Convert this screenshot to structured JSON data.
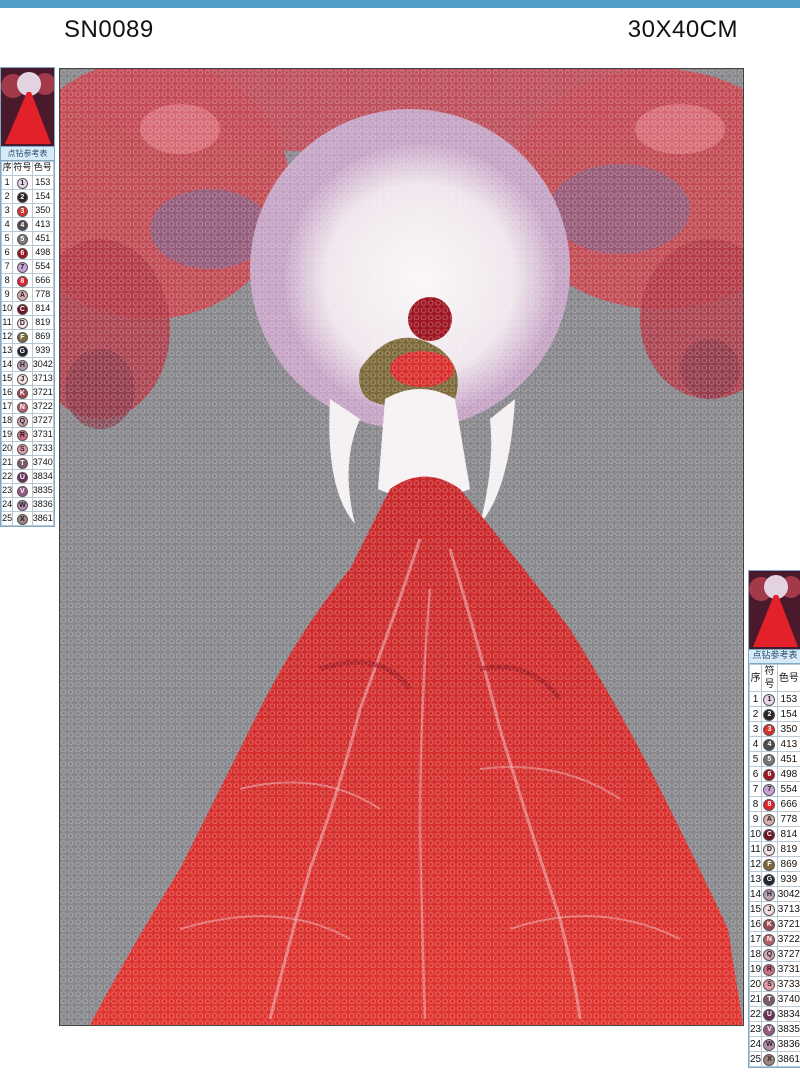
{
  "header": {
    "code": "SN0089",
    "size": "30X40CM"
  },
  "legend": {
    "title": "点钻参考表",
    "columns": [
      "序",
      "符号",
      "色号"
    ],
    "items": [
      {
        "no": "1",
        "symbol": "1",
        "code": "153",
        "color": "#e8d3e6"
      },
      {
        "no": "2",
        "symbol": "2",
        "code": "154",
        "color": "#2a2226"
      },
      {
        "no": "3",
        "symbol": "3",
        "code": "350",
        "color": "#d9302f"
      },
      {
        "no": "4",
        "symbol": "4",
        "code": "413",
        "color": "#4b4b4e"
      },
      {
        "no": "5",
        "symbol": "5",
        "code": "451",
        "color": "#7a7776"
      },
      {
        "no": "6",
        "symbol": "6",
        "code": "498",
        "color": "#9e1622"
      },
      {
        "no": "7",
        "symbol": "7",
        "code": "554",
        "color": "#c9a3d6"
      },
      {
        "no": "8",
        "symbol": "8",
        "code": "666",
        "color": "#e2212b"
      },
      {
        "no": "9",
        "symbol": "A",
        "code": "778",
        "color": "#d9aeb1"
      },
      {
        "no": "10",
        "symbol": "C",
        "code": "814",
        "color": "#6e1324"
      },
      {
        "no": "11",
        "symbol": "D",
        "code": "819",
        "color": "#f4e1e3"
      },
      {
        "no": "12",
        "symbol": "F",
        "code": "869",
        "color": "#7c6a3a"
      },
      {
        "no": "13",
        "symbol": "G",
        "code": "939",
        "color": "#1c2330"
      },
      {
        "no": "14",
        "symbol": "H",
        "code": "3042",
        "color": "#b89fb6"
      },
      {
        "no": "15",
        "symbol": "J",
        "code": "3713",
        "color": "#f6dcdc"
      },
      {
        "no": "16",
        "symbol": "K",
        "code": "3721",
        "color": "#9a4a52"
      },
      {
        "no": "17",
        "symbol": "N",
        "code": "3722",
        "color": "#b4606a"
      },
      {
        "no": "18",
        "symbol": "Q",
        "code": "3727",
        "color": "#d4a4b0"
      },
      {
        "no": "19",
        "symbol": "R",
        "code": "3731",
        "color": "#cf6f84"
      },
      {
        "no": "20",
        "symbol": "S",
        "code": "3733",
        "color": "#e49aa7"
      },
      {
        "no": "21",
        "symbol": "T",
        "code": "3740",
        "color": "#7b5b6b"
      },
      {
        "no": "22",
        "symbol": "U",
        "code": "3834",
        "color": "#6a3159"
      },
      {
        "no": "23",
        "symbol": "V",
        "code": "3835",
        "color": "#955a85"
      },
      {
        "no": "24",
        "symbol": "W",
        "code": "3836",
        "color": "#b88bb0"
      },
      {
        "no": "25",
        "symbol": "X",
        "code": "3861",
        "color": "#9e8381"
      }
    ]
  },
  "colors": {
    "background_gray": "#87878c",
    "moon": "#f1ecef",
    "moon_halo": "#c5a3c4",
    "dress_red": "#d9302f",
    "dress_dark": "#9e1622",
    "flowers": "#c9464f",
    "flowers_purple": "#8a6084",
    "hair": "#7c6a3a",
    "accent_blue": "#4f9ec7"
  }
}
